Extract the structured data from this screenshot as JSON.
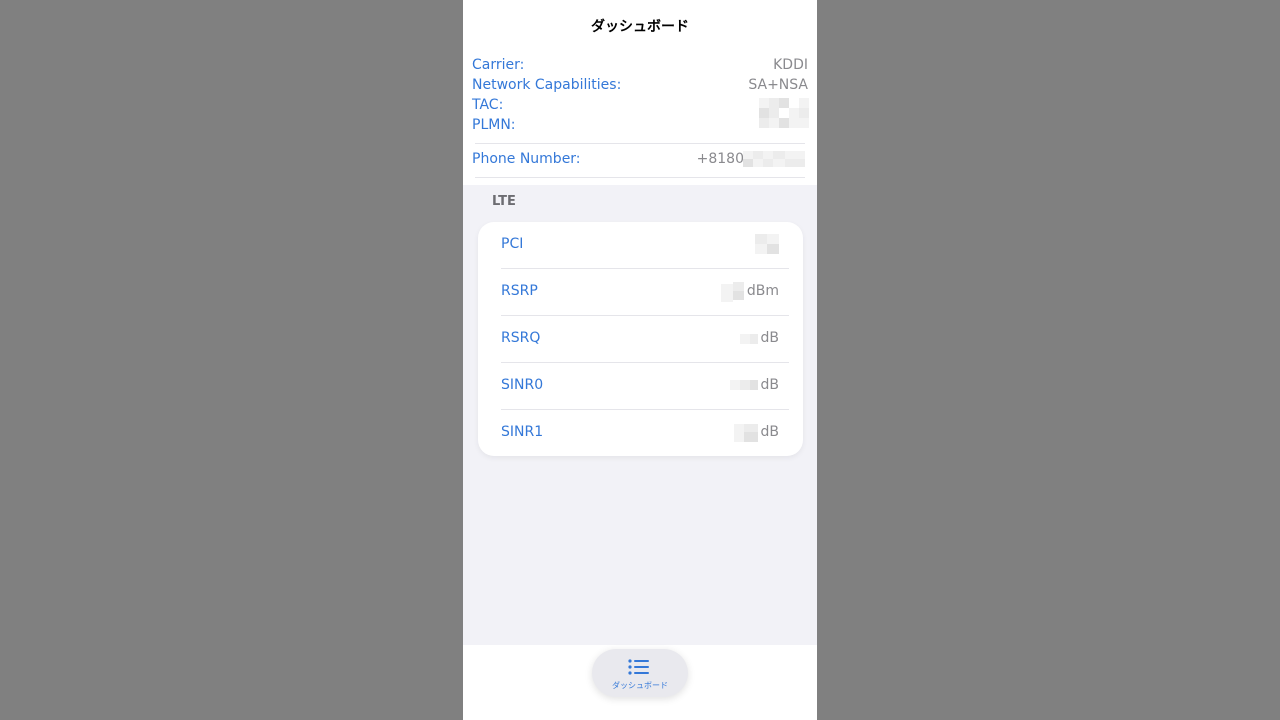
{
  "nav": {
    "title": "ダッシュボード"
  },
  "info": {
    "carrier": {
      "label": "Carrier:",
      "value": "KDDI"
    },
    "network_capabilities": {
      "label": "Network Capabilities:",
      "value": "SA+NSA"
    },
    "tac": {
      "label": "TAC:"
    },
    "plmn": {
      "label": "PLMN:"
    },
    "phone_number": {
      "label": "Phone Number:",
      "value": "+8180"
    }
  },
  "lte": {
    "header": "LTE",
    "rows": [
      {
        "label": "PCI",
        "unit": ""
      },
      {
        "label": "RSRP",
        "unit": "dBm"
      },
      {
        "label": "RSRQ",
        "unit": "dB"
      },
      {
        "label": "SINR0",
        "unit": "dB"
      },
      {
        "label": "SINR1",
        "unit": "dB"
      }
    ]
  },
  "tabbar": {
    "tabs": [
      {
        "label": "ダッシュボード",
        "icon": "list-icon",
        "selected": true
      }
    ]
  },
  "colors": {
    "accent": "#3478d8",
    "value_gray": "#8a8a8e",
    "background": "#f2f2f7"
  }
}
